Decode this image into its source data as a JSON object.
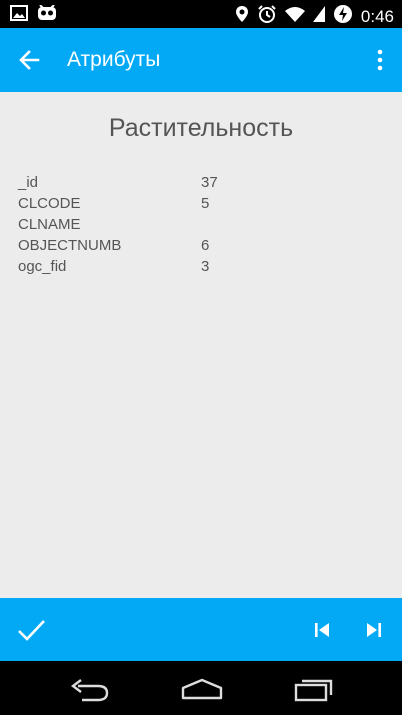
{
  "status_bar": {
    "time": "0:46",
    "icons": [
      "image-icon",
      "cyanogenmod-icon",
      "location-icon",
      "alarm-icon",
      "wifi-icon",
      "signal-icon",
      "battery-charging-icon"
    ]
  },
  "app_bar": {
    "title": "Атрибуты",
    "back_icon": "arrow-back-icon",
    "menu_icon": "more-vert-icon"
  },
  "content": {
    "layer_title": "Растительность",
    "attributes": [
      {
        "key": "_id",
        "value": "37"
      },
      {
        "key": "CLCODE",
        "value": "5"
      },
      {
        "key": "CLNAME",
        "value": ""
      },
      {
        "key": "OBJECTNUMB",
        "value": "6"
      },
      {
        "key": "ogc_fid",
        "value": "3"
      }
    ]
  },
  "bottom_bar": {
    "icons": [
      "check-icon",
      "skip-previous-icon",
      "skip-next-icon"
    ]
  },
  "nav_bar": {
    "icons": [
      "nav-back-icon",
      "nav-home-icon",
      "nav-recent-icon"
    ]
  },
  "colors": {
    "accent": "#03a9f4",
    "background": "#ececec",
    "text": "#555555"
  }
}
